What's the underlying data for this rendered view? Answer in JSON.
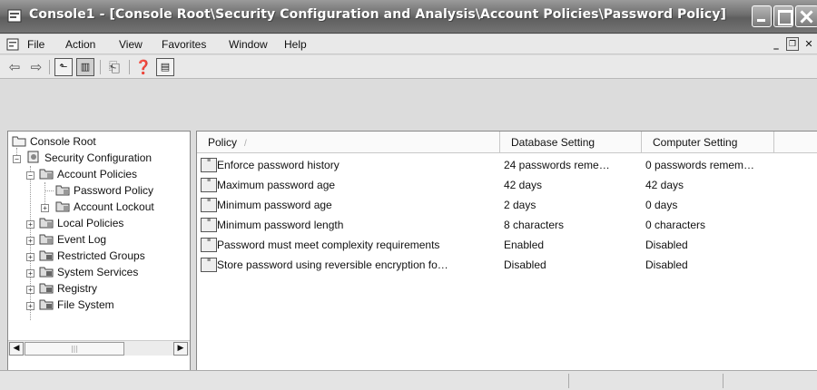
{
  "window": {
    "title": "Console1 - [Console Root\\Security Configuration and Analysis\\Account Policies\\Password Policy]"
  },
  "menu": {
    "items": [
      "File",
      "Action",
      "View",
      "Favorites",
      "Window",
      "Help"
    ]
  },
  "tree": {
    "root": "Console Root",
    "items": [
      {
        "label": "Security Configuration",
        "level": 1,
        "expander": "minus"
      },
      {
        "label": "Account Policies",
        "level": 2,
        "expander": "minus"
      },
      {
        "label": "Password Policy",
        "level": 3,
        "expander": "none",
        "selected": true
      },
      {
        "label": "Account Lockout",
        "level": 3,
        "expander": "plus"
      },
      {
        "label": "Local Policies",
        "level": 2,
        "expander": "plus"
      },
      {
        "label": "Event Log",
        "level": 2,
        "expander": "plus"
      },
      {
        "label": "Restricted Groups",
        "level": 2,
        "expander": "plus"
      },
      {
        "label": "System Services",
        "level": 2,
        "expander": "plus"
      },
      {
        "label": "Registry",
        "level": 2,
        "expander": "plus"
      },
      {
        "label": "File System",
        "level": 2,
        "expander": "plus"
      }
    ]
  },
  "list": {
    "columns": [
      "Policy",
      "Database Setting",
      "Computer Setting"
    ],
    "sort_indicator": "/",
    "rows": [
      {
        "policy": "Enforce password history",
        "database": "24 passwords reme…",
        "computer": "0 passwords remem…"
      },
      {
        "policy": "Maximum password age",
        "database": "42 days",
        "computer": "42 days"
      },
      {
        "policy": "Minimum password age",
        "database": "2 days",
        "computer": "0 days"
      },
      {
        "policy": "Minimum password length",
        "database": "8 characters",
        "computer": "0 characters"
      },
      {
        "policy": "Password must meet complexity requirements",
        "database": "Enabled",
        "computer": "Disabled"
      },
      {
        "policy": "Store password using reversible encryption fo…",
        "database": "Disabled",
        "computer": "Disabled"
      }
    ]
  }
}
